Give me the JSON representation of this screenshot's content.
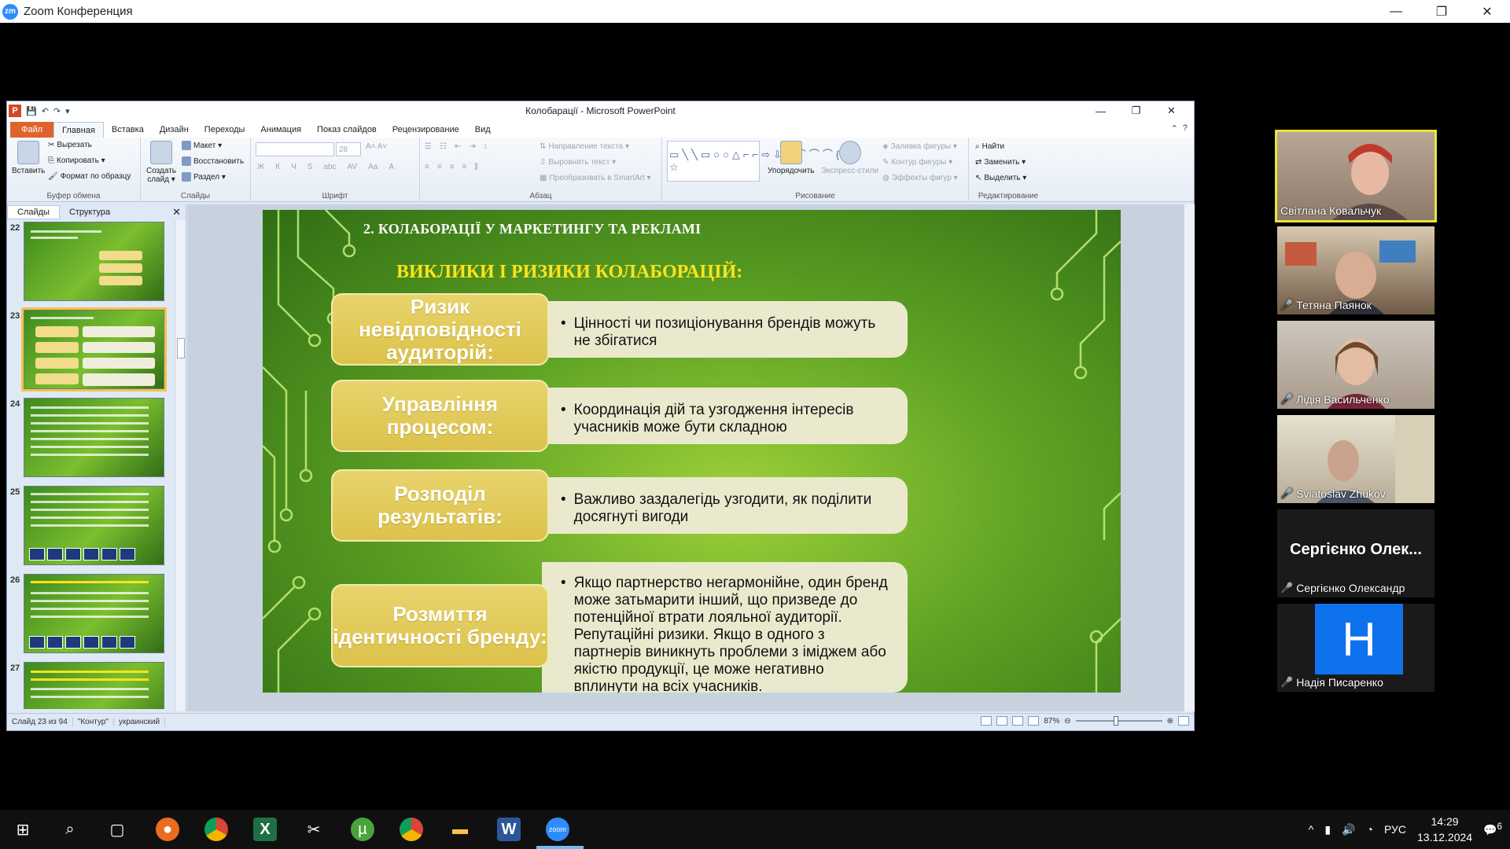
{
  "zoom": {
    "logo_text": "zm",
    "title": "Zoom Конференция",
    "controls": {
      "minimize": "—",
      "restore": "❐",
      "close": "✕"
    }
  },
  "ppt": {
    "title": "Колобарації - Microsoft PowerPoint",
    "logo": "P",
    "qat": [
      "💾",
      "↶",
      "↷",
      "▾"
    ],
    "tabs": [
      "Файл",
      "Главная",
      "Вставка",
      "Дизайн",
      "Переходы",
      "Анимация",
      "Показ слайдов",
      "Рецензирование",
      "Вид"
    ],
    "active_tab": "Главная",
    "ribbon": {
      "clipboard": {
        "label": "Буфер обмена",
        "paste": "Вставить",
        "cut": "Вырезать",
        "copy": "Копировать ▾",
        "format": "Формат по образцу"
      },
      "slides": {
        "label": "Слайды",
        "create": "Создать слайд ▾",
        "layout": "Макет ▾",
        "reset": "Восстановить",
        "section": "Раздел ▾"
      },
      "font": {
        "label": "Шрифт",
        "size": "28",
        "buttons": [
          "Ж",
          "К",
          "Ч",
          "S",
          "abc",
          "AV",
          "Aa",
          "A"
        ]
      },
      "paragraph": {
        "label": "Абзац",
        "direction": "Направление текста ▾",
        "align": "Выровнять текст ▾",
        "smartart": "Преобразовать в SmartArt ▾"
      },
      "drawing": {
        "label": "Рисование",
        "arrange": "Упорядочить",
        "styles": "Экспресс-стили",
        "fill": "Заливка фигуры ▾",
        "outline": "Контур фигуры ▾",
        "effects": "Эффекты фигур ▾"
      },
      "editing": {
        "label": "Редактирование",
        "find": "Найти",
        "replace": "Заменить ▾",
        "select": "Выделить ▾"
      }
    },
    "panel_tabs": [
      "Слайды",
      "Структура"
    ],
    "panel_close": "✕",
    "thumbnails": [
      {
        "num": "22"
      },
      {
        "num": "23",
        "selected": true
      },
      {
        "num": "24"
      },
      {
        "num": "25"
      },
      {
        "num": "26"
      },
      {
        "num": "27"
      }
    ],
    "status": {
      "slide": "Слайд 23 из 94",
      "theme": "\"Контур\"",
      "lang": "украинский",
      "zoom": "87%"
    }
  },
  "slide": {
    "heading": "2. КОЛАБОРАЦІЇ У МАРКЕТИНГУ ТА РЕКЛАМІ",
    "subheading": "ВИКЛИКИ І РИЗИКИ КОЛАБОРАЦІЙ:",
    "risks": [
      {
        "title": "Ризик невідповідності аудиторій:",
        "text": "Цінності чи позиціонування брендів можуть не збігатися"
      },
      {
        "title": "Управління процесом:",
        "text": "Координація дій та узгодження інтересів учасників може бути складною"
      },
      {
        "title": "Розподіл результатів:",
        "text": "Важливо заздалегідь узгодити, як поділити досягнуті вигоди"
      },
      {
        "title": "Розмиття ідентичності бренду:",
        "text": "Якщо партнерство негармонійне, один бренд може затьмарити інший, що призведе до потенційної втрати лояльної аудиторії. Репутаційні ризики. Якщо в одного з партнерів виникнуть проблеми з іміджем або якістю продукції, це може негативно вплинути на всіх учасників."
      }
    ],
    "bullet": "•"
  },
  "participants": [
    {
      "name": "Світлана Ковальчук",
      "active": true,
      "muted": false
    },
    {
      "name": "Тетяна Паянок",
      "muted": true
    },
    {
      "name": "Лідія Васильченко",
      "muted": true
    },
    {
      "name": "Sviatoslav Zhukov",
      "muted": true
    },
    {
      "name": "Сергієнко Олександр",
      "display": "Сергієнко Олек...",
      "muted": true
    },
    {
      "name": "Надія Писаренко",
      "avatar_letter": "H",
      "muted": true
    }
  ],
  "taskbar": {
    "lang": "РУС",
    "time": "14:29",
    "date": "13.12.2024",
    "notifications": "6"
  },
  "colors": {
    "zoom_blue": "#2d8cff",
    "active_outline": "#e7e33e",
    "file_tab": "#e0632d",
    "risk_box": "#dcc24b"
  }
}
